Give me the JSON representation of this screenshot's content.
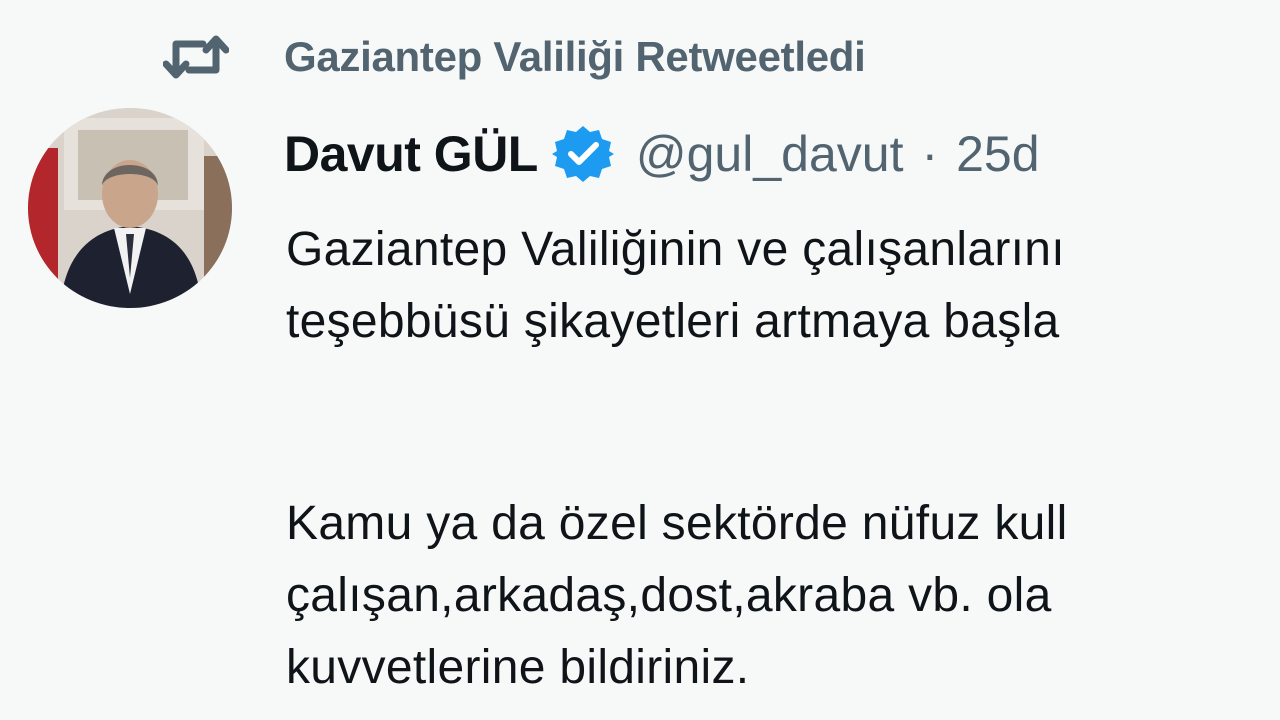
{
  "retweet": {
    "icon": "retweet-icon",
    "text": "Gaziantep Valiliği Retweetledi"
  },
  "tweet": {
    "author": {
      "display_name": "Davut GÜL",
      "verified": true,
      "verified_icon": "verified-badge-icon",
      "handle": "@gul_davut",
      "separator": "·",
      "time": "25d"
    },
    "paragraph1": [
      "Gaziantep Valiliğinin ve çalışanlarını",
      "teşebbüsü şikayetleri artmaya başla"
    ],
    "paragraph2": [
      "Kamu ya da özel sektörde nüfuz kull",
      "çalışan,arkadaş,dost,akraba vb. ola",
      "kuvvetlerine bildiriniz."
    ]
  },
  "colors": {
    "background": "#f7f9f9",
    "text_primary": "#0f1419",
    "text_secondary": "#536471",
    "verified_blue": "#1d9bf0"
  }
}
